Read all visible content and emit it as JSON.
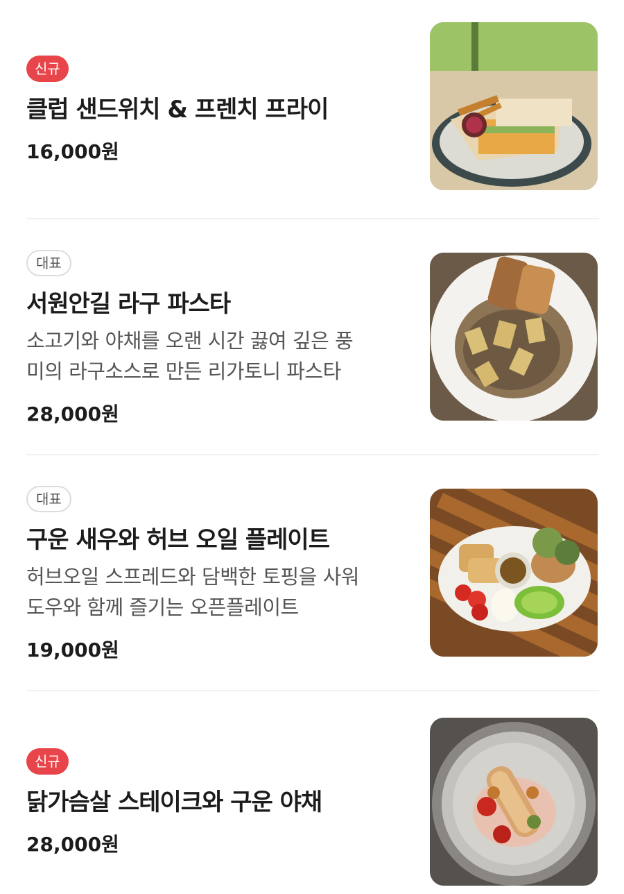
{
  "menu": {
    "items": [
      {
        "badge": "신규",
        "name": "클럽 샌드위치 & 프렌치 프라이",
        "description_lines": [],
        "price": "16,000원"
      },
      {
        "badge": "대표",
        "name": "서원안길 라구 파스타",
        "description_lines": [
          "소고기와 야채를 오랜 시간 끓여 깊은 풍",
          "미의 라구소스로 만든 리가토니 파스타"
        ],
        "price": "28,000원"
      },
      {
        "badge": "대표",
        "name": "구운 새우와 허브 오일 플레이트",
        "description_lines": [
          "허브오일 스프레드와 담백한 토핑을 사워",
          "도우와 함께 즐기는 오픈플레이트"
        ],
        "price": "19,000원"
      },
      {
        "badge": "신규",
        "name": "닭가슴살 스테이크와 구운 야채",
        "description_lines": [],
        "price": "28,000원"
      }
    ]
  },
  "colors": {
    "new_badge": "#e8454a",
    "signature_badge_border": "#dcdcdc",
    "price_text": "#1c1c1c"
  }
}
